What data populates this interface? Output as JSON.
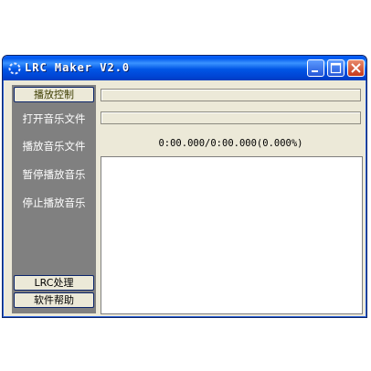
{
  "window": {
    "title": "LRC Maker V2.0"
  },
  "sidebar": {
    "top_button": "播放控制",
    "items": [
      {
        "label": "打开音乐文件"
      },
      {
        "label": "播放音乐文件"
      },
      {
        "label": "暂停播放音乐"
      },
      {
        "label": "停止播放音乐"
      }
    ],
    "lrc_button": "LRC处理",
    "help_button": "软件帮助"
  },
  "main": {
    "time_display": "0:00.000/0:00.000(0.000%)",
    "lyrics_text": ""
  },
  "colors": {
    "titlebar": "#0058ee",
    "sidebar": "#808080",
    "window_bg": "#ece9d8"
  }
}
